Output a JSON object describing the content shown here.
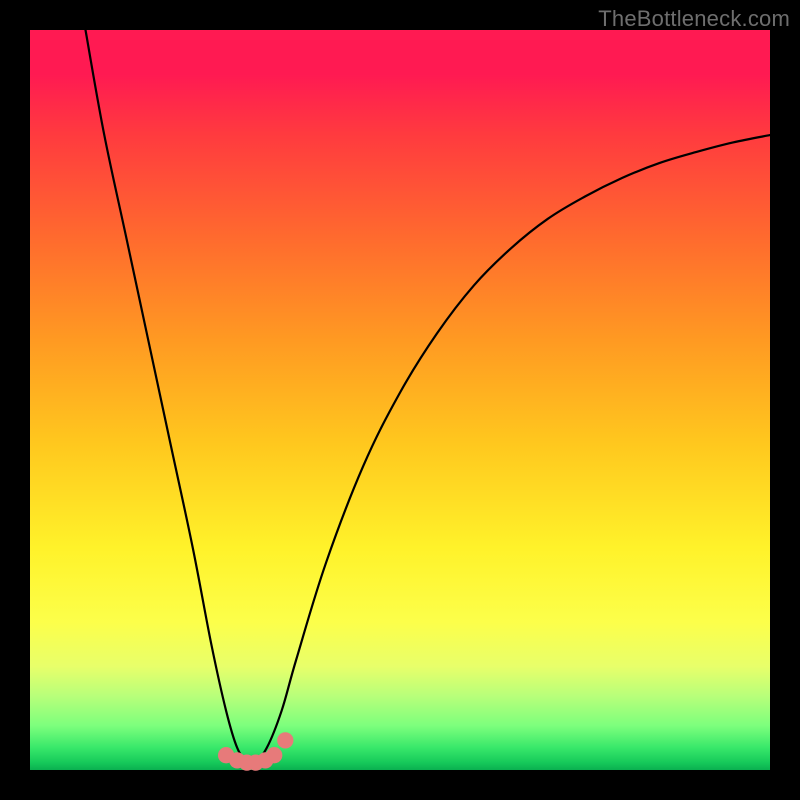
{
  "watermark": "TheBottleneck.com",
  "chart_data": {
    "type": "line",
    "title": "",
    "xlabel": "",
    "ylabel": "",
    "xlim": [
      0,
      1
    ],
    "ylim": [
      0,
      1
    ],
    "grid": false,
    "legend": false,
    "series": [
      {
        "name": "curve",
        "color": "#000000",
        "x": [
          0.075,
          0.1,
          0.13,
          0.16,
          0.19,
          0.22,
          0.245,
          0.265,
          0.28,
          0.293,
          0.305,
          0.32,
          0.34,
          0.36,
          0.4,
          0.45,
          0.5,
          0.55,
          0.6,
          0.65,
          0.7,
          0.75,
          0.8,
          0.85,
          0.9,
          0.95,
          1.0
        ],
        "y": [
          1.0,
          0.86,
          0.72,
          0.58,
          0.44,
          0.3,
          0.17,
          0.08,
          0.03,
          0.013,
          0.013,
          0.03,
          0.08,
          0.15,
          0.28,
          0.41,
          0.51,
          0.59,
          0.655,
          0.705,
          0.745,
          0.775,
          0.8,
          0.82,
          0.835,
          0.848,
          0.858
        ]
      }
    ],
    "markers": {
      "name": "bottom-dots",
      "color": "#e77a7a",
      "radius_frac": 0.011,
      "points": [
        {
          "x": 0.265,
          "y": 0.02
        },
        {
          "x": 0.28,
          "y": 0.013
        },
        {
          "x": 0.293,
          "y": 0.01
        },
        {
          "x": 0.305,
          "y": 0.01
        },
        {
          "x": 0.318,
          "y": 0.013
        },
        {
          "x": 0.33,
          "y": 0.02
        },
        {
          "x": 0.345,
          "y": 0.04
        }
      ]
    },
    "gradient_stops": [
      {
        "pos": 0.0,
        "color": "#ff1a52"
      },
      {
        "pos": 0.8,
        "color": "#fcff4a"
      },
      {
        "pos": 0.94,
        "color": "#7dff7d"
      },
      {
        "pos": 1.0,
        "color": "#0ab050"
      }
    ]
  }
}
